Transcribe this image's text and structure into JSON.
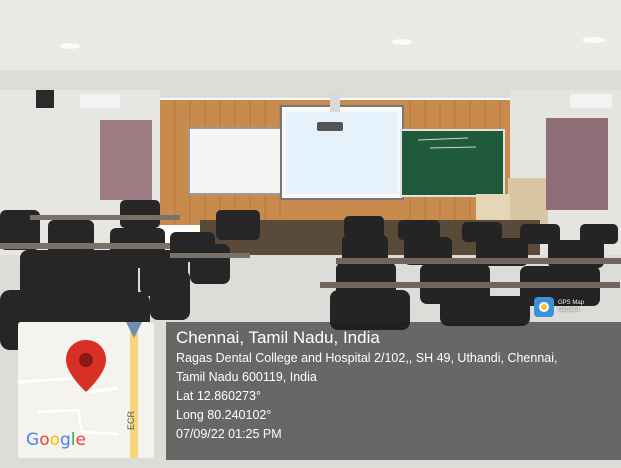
{
  "overlay": {
    "city": "Chennai, Tamil Nadu, India",
    "address_line1": "Ragas Dental College and Hospital 2/102,, SH 49, Uthandi, Chennai,",
    "address_line2": "Tamil Nadu 600119, India",
    "latitude": "Lat 12.860273°",
    "longitude": "Long 80.240102°",
    "datetime": "07/09/22 01:25 PM"
  },
  "badge": {
    "app_name_line1": "GPS Map",
    "app_name_line2": "Camera"
  },
  "map": {
    "road_label": "ECR",
    "logo_letters": [
      "G",
      "o",
      "o",
      "g",
      "l",
      "e"
    ]
  },
  "colors": {
    "wood_wall": "#c98a4d",
    "chalkboard": "#1f5a3a",
    "pin": "#d93025",
    "overlay": "#1e1e1e"
  }
}
